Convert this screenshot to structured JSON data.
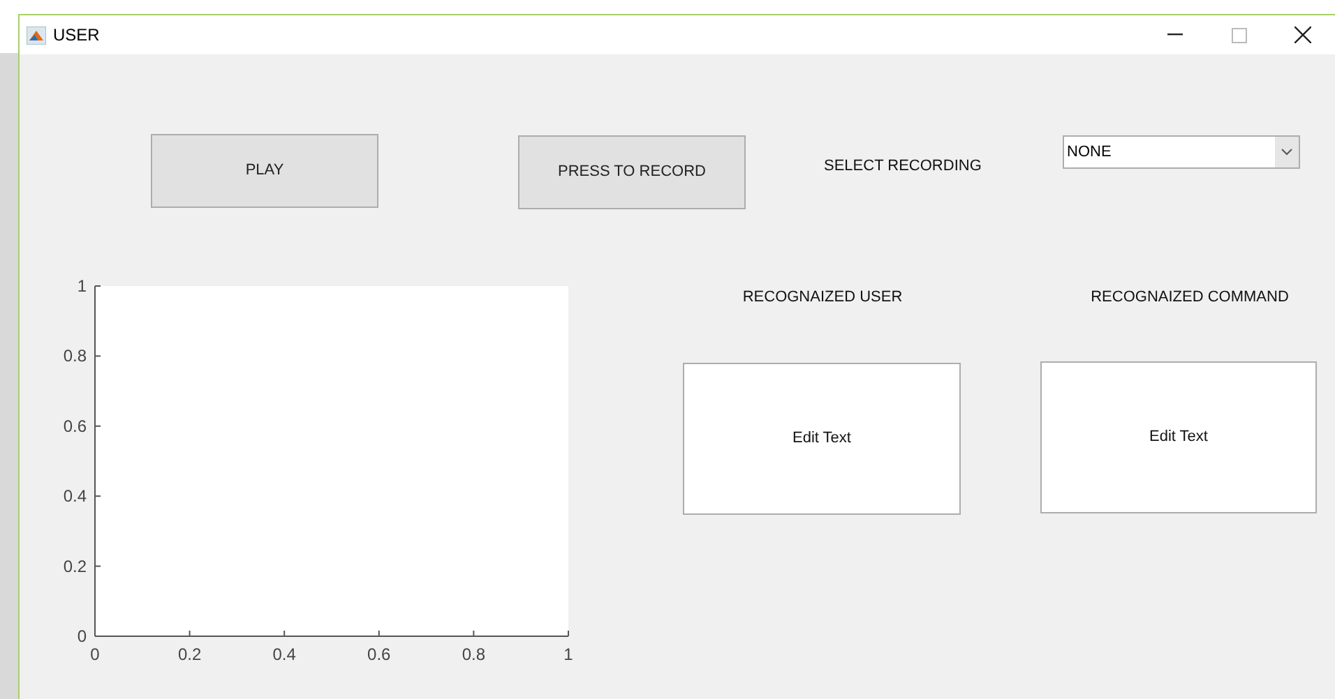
{
  "window": {
    "title": "USER"
  },
  "buttons": [
    {
      "label": "PLAY"
    },
    {
      "label": "PRESS TO RECORD"
    }
  ],
  "select_recording": {
    "label": "SELECT RECORDING",
    "value": "NONE"
  },
  "axes": {
    "chart_data": {
      "type": "line",
      "xlim": [
        0,
        1
      ],
      "ylim": [
        0,
        1
      ],
      "xticks": [
        0,
        0.2,
        0.4,
        0.6,
        0.8,
        1
      ],
      "yticks": [
        0,
        0.2,
        0.4,
        0.6,
        0.8,
        1
      ]
    }
  },
  "outputs": [
    {
      "label": "RECOGNAIZED USER",
      "value": "Edit Text"
    },
    {
      "label": "RECOGNAIZED COMMAND",
      "value": "Edit Text"
    }
  ]
}
